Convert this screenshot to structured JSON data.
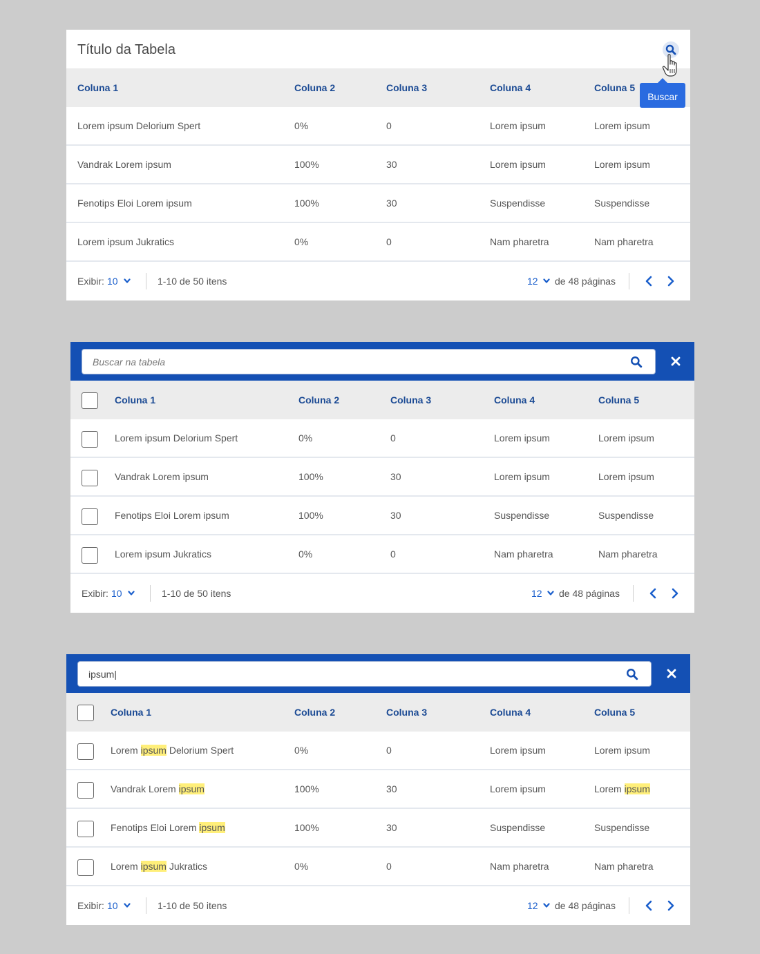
{
  "table1": {
    "title": "Título da Tabela",
    "tooltip": "Buscar",
    "columns": [
      "Coluna 1",
      "Coluna 2",
      "Coluna 3",
      "Coluna 4",
      "Coluna 5"
    ],
    "rows": [
      [
        "Lorem ipsum Delorium Spert",
        "0%",
        "0",
        "Lorem ipsum",
        "Lorem ipsum"
      ],
      [
        "Vandrak Lorem ipsum",
        "100%",
        "30",
        "Lorem ipsum",
        "Lorem ipsum"
      ],
      [
        "Fenotips Eloi Lorem ipsum",
        "100%",
        "30",
        "Suspendisse",
        "Suspendisse"
      ],
      [
        "Lorem ipsum Jukratics",
        "0%",
        "0",
        "Nam pharetra",
        "Nam pharetra"
      ]
    ],
    "footer": {
      "show_label": "Exibir:",
      "show_value": "10",
      "range_text": "1-10 de 50 itens",
      "page_value": "12",
      "pages_text": "de 48 páginas"
    }
  },
  "table2": {
    "search_placeholder": "Buscar na tabela",
    "columns": [
      "Coluna 1",
      "Coluna 2",
      "Coluna 3",
      "Coluna 4",
      "Coluna 5"
    ],
    "rows": [
      [
        "Lorem ipsum Delorium Spert",
        "0%",
        "0",
        "Lorem ipsum",
        "Lorem ipsum"
      ],
      [
        "Vandrak Lorem ipsum",
        "100%",
        "30",
        "Lorem ipsum",
        "Lorem ipsum"
      ],
      [
        "Fenotips Eloi Lorem ipsum",
        "100%",
        "30",
        "Suspendisse",
        "Suspendisse"
      ],
      [
        "Lorem ipsum Jukratics",
        "0%",
        "0",
        "Nam pharetra",
        "Nam pharetra"
      ]
    ],
    "footer": {
      "show_label": "Exibir:",
      "show_value": "10",
      "range_text": "1-10 de 50 itens",
      "page_value": "12",
      "pages_text": "de 48 páginas"
    }
  },
  "table3": {
    "search_value": "ipsum|",
    "highlight_term": "ipsum",
    "columns": [
      "Coluna 1",
      "Coluna 2",
      "Coluna 3",
      "Coluna 4",
      "Coluna 5"
    ],
    "rows": [
      [
        [
          [
            "Lorem ",
            false
          ],
          [
            "ipsum",
            true
          ],
          [
            " Delorium Spert",
            false
          ]
        ],
        "0%",
        "0",
        "Lorem ipsum",
        "Lorem ipsum"
      ],
      [
        [
          [
            "Vandrak Lorem ",
            false
          ],
          [
            "ipsum",
            true
          ]
        ],
        "100%",
        "30",
        "Lorem ipsum",
        [
          [
            "Lorem ",
            false
          ],
          [
            "ipsum",
            true
          ]
        ]
      ],
      [
        [
          [
            "Fenotips Eloi Lorem ",
            false
          ],
          [
            "ipsum",
            true
          ]
        ],
        "100%",
        "30",
        "Suspendisse",
        "Suspendisse"
      ],
      [
        [
          [
            "Lorem ",
            false
          ],
          [
            "ipsum",
            true
          ],
          [
            " Jukratics",
            false
          ]
        ],
        "0%",
        "0",
        "Nam pharetra",
        "Nam pharetra"
      ]
    ],
    "footer": {
      "show_label": "Exibir:",
      "show_value": "10",
      "range_text": "1-10 de 50 itens",
      "page_value": "12",
      "pages_text": "de 48 páginas"
    }
  },
  "colors": {
    "primary": "#1450b4",
    "header_text": "#1b4a94",
    "link_blue": "#1b5fcc",
    "highlight": "#ffef7a",
    "tooltip_bg": "#2a6be0"
  },
  "icons": {
    "search": "search-icon",
    "close": "close-icon",
    "prev": "chevron-left-icon",
    "next": "chevron-right-icon",
    "dropdown": "chevron-down-icon",
    "cursor": "hand-cursor-icon"
  }
}
